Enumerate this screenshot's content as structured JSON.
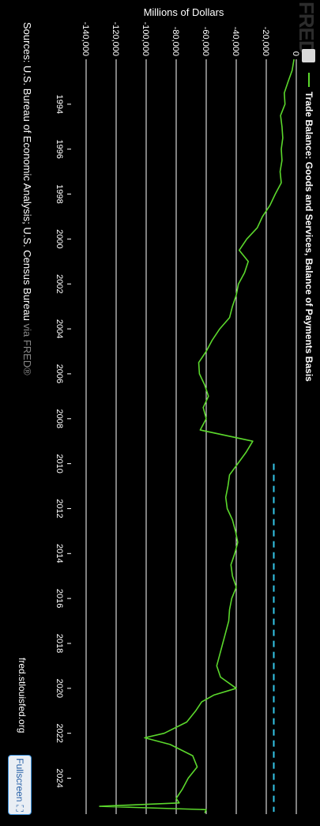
{
  "logo": {
    "text": "FRED"
  },
  "legend": {
    "label": "Trade Balance: Goods and Services, Balance of Payments Basis"
  },
  "y_axis_title": "Millions of Dollars",
  "source": {
    "text": "Sources: U.S. Bureau of Economic Analysis; U.S. Census Bureau",
    "via": "via FRED®"
  },
  "credit": "fred.stlouisfed.org",
  "fullscreen_label": "Fullscreen",
  "colors": {
    "background": "#000000",
    "series": "#5bd82c",
    "recession_marker": "#35c6e8",
    "grid": "#ffffff"
  },
  "chart_data": {
    "type": "line",
    "title": "",
    "ylabel": "Millions of Dollars",
    "xlim": [
      1992.0,
      2025.6
    ],
    "ylim": [
      -150000,
      0
    ],
    "y_ticks": [
      0,
      -20000,
      -40000,
      -60000,
      -80000,
      -100000,
      -120000,
      -140000
    ],
    "y_tick_labels": [
      "0",
      "-20,000",
      "-40,000",
      "-60,000",
      "-80,000",
      "-100,000",
      "-120,000",
      "-140,000"
    ],
    "x_ticks": [
      1994,
      1996,
      1998,
      2000,
      2002,
      2004,
      2006,
      2008,
      2010,
      2012,
      2014,
      2016,
      2018,
      2020,
      2022,
      2024
    ],
    "grid": true,
    "series": [
      {
        "name": "Trade Balance: Goods and Services, Balance of Payments Basis",
        "x": [
          1992.0,
          1992.5,
          1993.0,
          1993.5,
          1994.0,
          1994.5,
          1995.0,
          1995.5,
          1996.0,
          1996.5,
          1997.0,
          1997.5,
          1998.0,
          1998.5,
          1999.0,
          1999.5,
          2000.0,
          2000.5,
          2001.0,
          2001.5,
          2002.0,
          2002.5,
          2003.0,
          2003.5,
          2004.0,
          2004.5,
          2005.0,
          2005.5,
          2006.0,
          2006.5,
          2007.0,
          2007.5,
          2008.0,
          2008.5,
          2009.0,
          2009.5,
          2010.0,
          2010.5,
          2011.0,
          2011.5,
          2012.0,
          2012.5,
          2013.0,
          2013.5,
          2014.0,
          2014.5,
          2015.0,
          2015.5,
          2016.0,
          2016.5,
          2017.0,
          2017.5,
          2018.0,
          2018.5,
          2019.0,
          2019.5,
          2020.0,
          2020.3,
          2020.6,
          2021.0,
          2021.5,
          2022.0,
          2022.2,
          2022.5,
          2023.0,
          2023.5,
          2024.0,
          2024.5,
          2024.9,
          2025.1,
          2025.25,
          2025.4,
          2025.55
        ],
        "values": [
          -1500,
          -2800,
          -5500,
          -8000,
          -7500,
          -10500,
          -9500,
          -9000,
          -10000,
          -9500,
          -10800,
          -10000,
          -14000,
          -17500,
          -22500,
          -26000,
          -33000,
          -38000,
          -32000,
          -34500,
          -38500,
          -40000,
          -42500,
          -44500,
          -51000,
          -56000,
          -60000,
          -65000,
          -64500,
          -61000,
          -58500,
          -62000,
          -60000,
          -64000,
          -29000,
          -33500,
          -39000,
          -44500,
          -45500,
          -47000,
          -46000,
          -42500,
          -40500,
          -39000,
          -41000,
          -43500,
          -42500,
          -40000,
          -43000,
          -44500,
          -45000,
          -47000,
          -49000,
          -51000,
          -53000,
          -50500,
          -40000,
          -55000,
          -63000,
          -67000,
          -73000,
          -88000,
          -101000,
          -84000,
          -69000,
          -66000,
          -72000,
          -76000,
          -80000,
          -78000,
          -131000,
          -60000,
          -61000
        ]
      }
    ],
    "reference_line": {
      "y": -15000,
      "x_start": 2010.0,
      "x_end": 2025.5,
      "style": "dashed"
    }
  }
}
